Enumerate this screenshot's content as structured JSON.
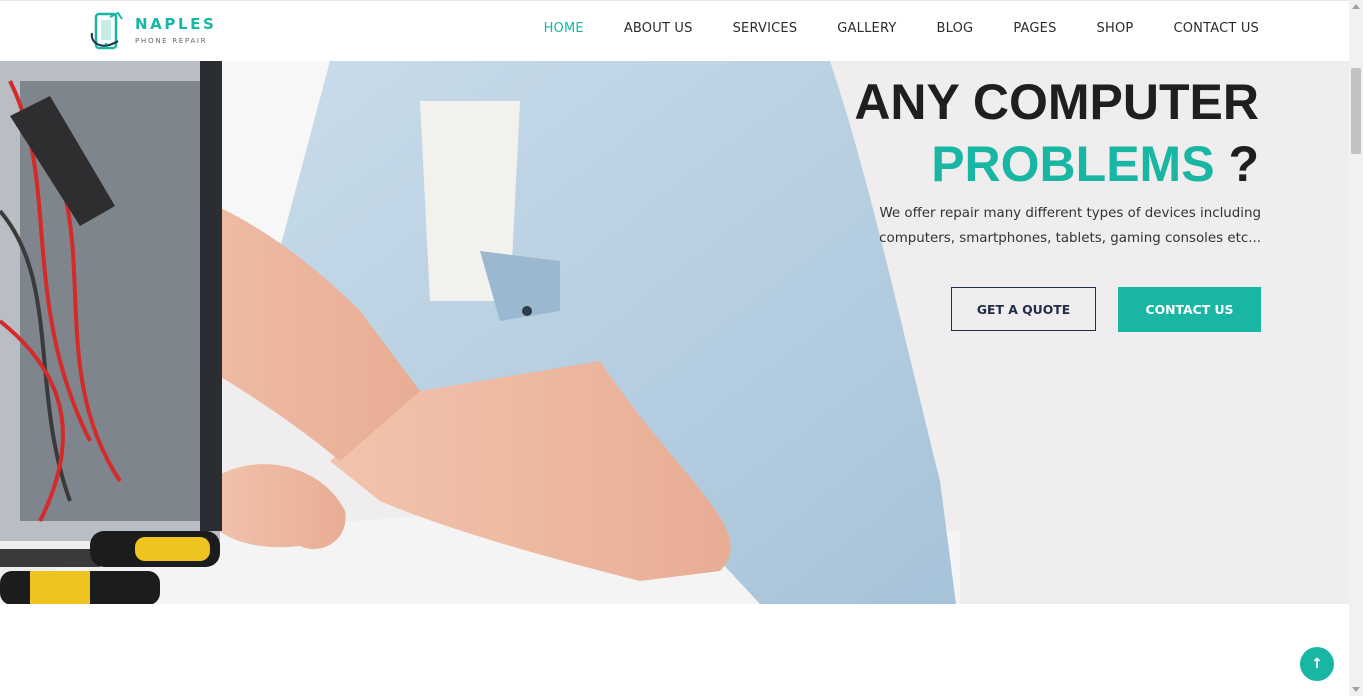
{
  "colors": {
    "accent": "#19b6a4",
    "dark": "#1f1f1f",
    "navy": "#1f2c4a"
  },
  "logo": {
    "title": "NAPLES",
    "subtitle": "PHONE REPAIR",
    "icon": "phone-logo-icon"
  },
  "nav": {
    "items": [
      {
        "label": "HOME",
        "active": true
      },
      {
        "label": "ABOUT US"
      },
      {
        "label": "SERVICES"
      },
      {
        "label": "GALLERY"
      },
      {
        "label": "BLOG"
      },
      {
        "label": "PAGES"
      },
      {
        "label": "SHOP"
      },
      {
        "label": "CONTACT US"
      }
    ]
  },
  "hero": {
    "title_line1": "ANY COMPUTER",
    "title_accent": "PROBLEMS",
    "title_mark": " ?",
    "description_line1": "We offer repair many different types of devices including",
    "description_line2": "computers, smartphones, tablets, gaming consoles etc...",
    "quote_button": "GET A QUOTE",
    "contact_button": "CONTACT US",
    "image": "technician-repairing-computer-photo"
  },
  "scroll_top": {
    "icon": "arrow-up-icon",
    "glyph": "↑"
  }
}
